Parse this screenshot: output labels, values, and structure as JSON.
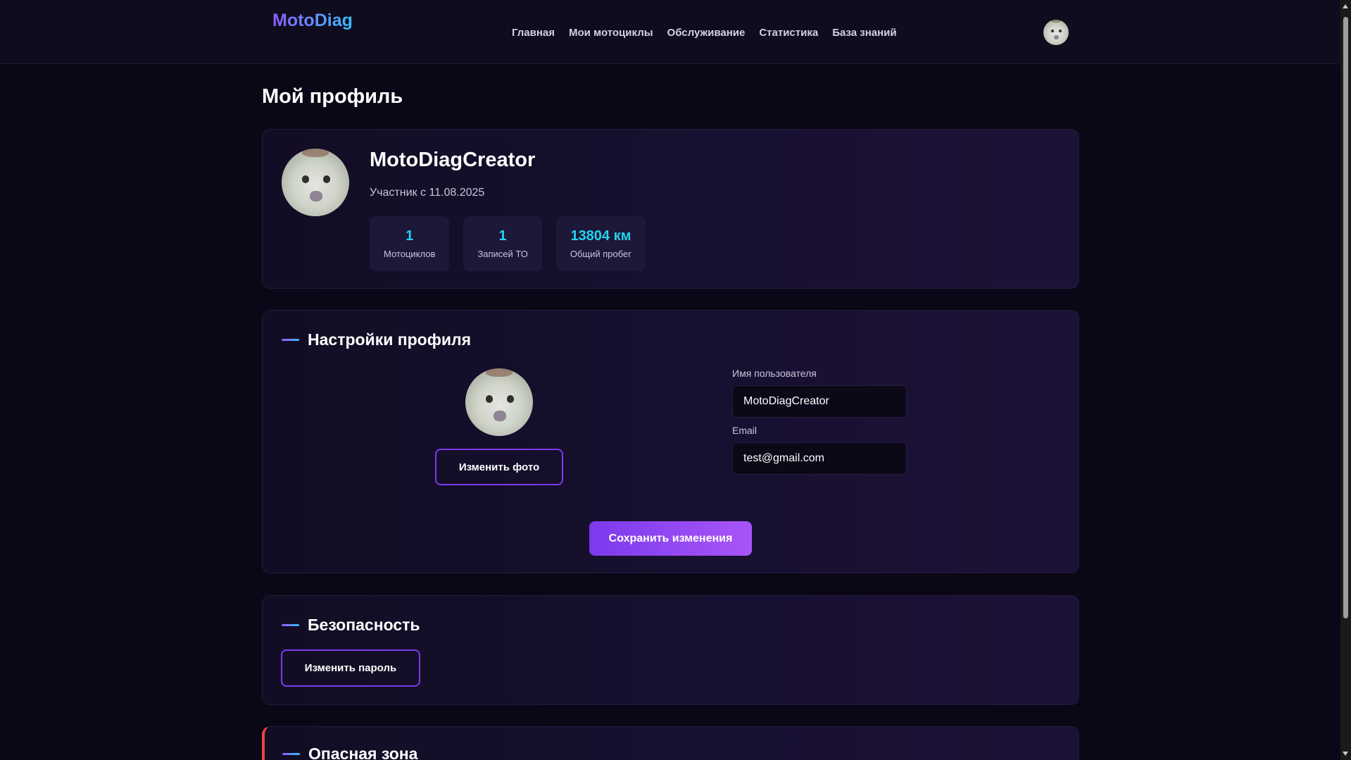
{
  "header": {
    "logo": "MotoDiag",
    "nav": [
      "Главная",
      "Мои мотоциклы",
      "Обслуживание",
      "Статистика",
      "База знаний"
    ]
  },
  "page": {
    "title": "Мой профиль"
  },
  "profile": {
    "username": "MotoDiagCreator",
    "member_since": "Участник с 11.08.2025",
    "stats": [
      {
        "value": "1",
        "label": "Мотоциклов"
      },
      {
        "value": "1",
        "label": "Записей ТО"
      },
      {
        "value": "13804 км",
        "label": "Общий пробег"
      }
    ]
  },
  "settings": {
    "title": "Настройки профиля",
    "change_photo": "Изменить фото",
    "username_label": "Имя пользователя",
    "username_value": "MotoDiagCreator",
    "email_label": "Email",
    "email_value": "test@gmail.com",
    "save": "Сохранить изменения"
  },
  "security": {
    "title": "Безопасность",
    "change_password": "Изменить пароль"
  },
  "danger": {
    "title": "Опасная зона"
  },
  "colors": {
    "accent": "#7c3aed",
    "stat": "#22d3ee",
    "danger": "#ef4444"
  }
}
